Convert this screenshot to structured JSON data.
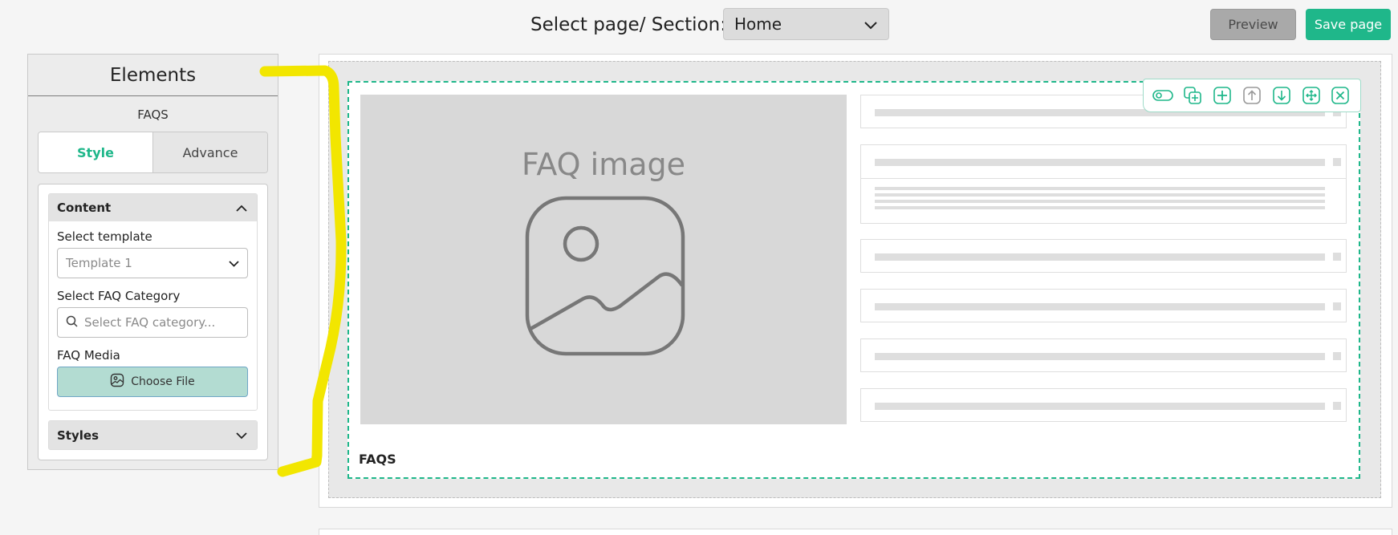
{
  "header": {
    "section_label": "Select page/ Section:",
    "section_value": "Home",
    "preview_label": "Preview",
    "save_label": "Save page"
  },
  "panel": {
    "title": "Elements",
    "element_name": "FAQS",
    "tabs": [
      {
        "label": "Style",
        "active": true
      },
      {
        "label": "Advance",
        "active": false
      }
    ],
    "content": {
      "heading": "Content",
      "template_label": "Select template",
      "template_value": "Template 1",
      "category_label": "Select FAQ Category",
      "category_placeholder": "Select FAQ category...",
      "media_label": "FAQ Media",
      "choose_file_label": "Choose File"
    },
    "styles_heading": "Styles"
  },
  "canvas": {
    "faq_image_title": "FAQ image",
    "faq_caption": "FAQS",
    "toolbar_icons": [
      "toggle-icon",
      "duplicate-icon",
      "add-icon",
      "move-up-icon",
      "move-down-icon",
      "move-icon",
      "close-icon"
    ]
  },
  "colors": {
    "accent": "#1fb78a",
    "annotation": "#f2e600",
    "preview_button": "#a9a9a9",
    "file_button": "#b3dcd2"
  }
}
